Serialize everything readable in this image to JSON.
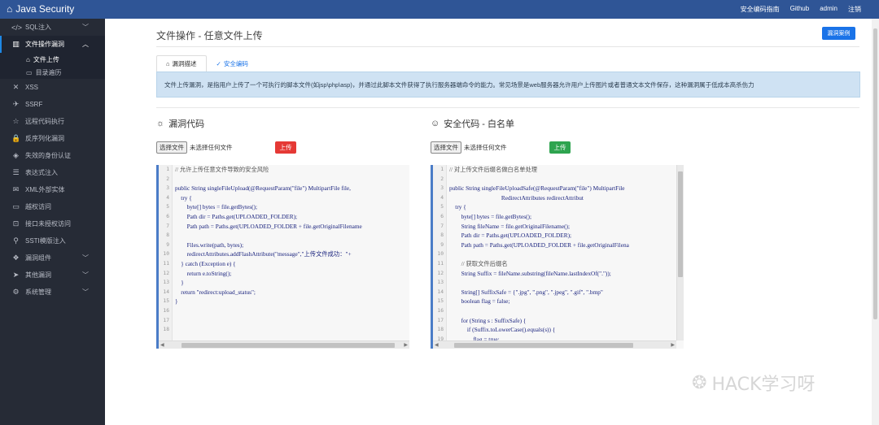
{
  "brand": {
    "title": "Java Security"
  },
  "topnav": [
    "安全编码指南",
    "Github",
    "admin",
    "注销"
  ],
  "sidebar": {
    "items": [
      {
        "label": "SQL注入",
        "icon": "code-icon",
        "glyph": "</>",
        "chevron": true
      },
      {
        "label": "文件操作漏洞",
        "icon": "file-icon",
        "glyph": "▥",
        "chevron": true,
        "open": true,
        "children": [
          {
            "label": "文件上传",
            "icon": "upload-icon",
            "glyph": "⌂",
            "current": true
          },
          {
            "label": "目录遍历",
            "icon": "folder-icon",
            "glyph": "▭"
          }
        ]
      },
      {
        "label": "XSS",
        "icon": "x-icon",
        "glyph": "✕"
      },
      {
        "label": "SSRF",
        "icon": "globe-icon",
        "glyph": "✈"
      },
      {
        "label": "远程代码执行",
        "icon": "star-icon",
        "glyph": "☆"
      },
      {
        "label": "反序列化漏洞",
        "icon": "lock-icon",
        "glyph": "🔒"
      },
      {
        "label": "失效的身份认证",
        "icon": "shield-icon",
        "glyph": "◈"
      },
      {
        "label": "表达式注入",
        "icon": "list-icon",
        "glyph": "☰"
      },
      {
        "label": "XML外部实体",
        "icon": "mail-icon",
        "glyph": "✉"
      },
      {
        "label": "越权访问",
        "icon": "monitor-icon",
        "glyph": "▭"
      },
      {
        "label": "接口未授权访问",
        "icon": "link-icon",
        "glyph": "⊡"
      },
      {
        "label": "SSTI模版注入",
        "icon": "plug-icon",
        "glyph": "⚲"
      },
      {
        "label": "漏洞组件",
        "icon": "component-icon",
        "glyph": "❖",
        "chevron": true
      },
      {
        "label": "其他漏洞",
        "icon": "send-icon",
        "glyph": "➤",
        "chevron": true
      },
      {
        "label": "系统管理",
        "icon": "settings-icon",
        "glyph": "⚙",
        "chevron": true
      }
    ]
  },
  "page": {
    "title": "文件操作 - 任意文件上传",
    "vuln_button": "漏洞案例",
    "tabs": [
      {
        "label": "漏洞描述",
        "icon": "bookmark-icon",
        "glyph": "⌂",
        "active": true
      },
      {
        "label": "安全编码",
        "icon": "shield-check-icon",
        "glyph": "✓",
        "active": false
      }
    ],
    "description": "文件上传漏洞，是指用户上传了一个可执行的脚本文件(如jsp\\php\\asp)，并通过此脚本文件获得了执行服务器端命令的能力。常见场景是web服务器允许用户上传图片或者普通文本文件保存，这种漏洞属于低成本高杀伤力"
  },
  "left_panel": {
    "title": "漏洞代码",
    "icon": "bug-icon",
    "choose_file": "选择文件",
    "no_file": "未选择任何文件",
    "upload": "上传",
    "upload_color": "#e53935",
    "line_numbers": [
      "1",
      "2",
      "3",
      "4",
      "5",
      "6",
      "7",
      "8",
      "9",
      "10",
      "11",
      "12",
      "13",
      "14",
      "15",
      "16",
      "17",
      "18"
    ],
    "lines": [
      "// 允许上传任意文件导致的安全风险",
      "",
      "public String singleFileUpload(@RequestParam(\"file\") MultipartFile file,",
      "    try {",
      "        byte[] bytes = file.getBytes();",
      "        Path dir = Paths.get(UPLOADED_FOLDER);",
      "        Path path = Paths.get(UPLOADED_FOLDER + file.getOriginalFilename",
      "",
      "        Files.write(path, bytes);",
      "        redirectAttributes.addFlashAttribute(\"message\",\"上传文件成功：\"+",
      "    } catch (Exception e) {",
      "        return e.toString();",
      "    }",
      "    return \"redirect:upload_status\";",
      "}",
      "",
      "",
      ""
    ]
  },
  "right_panel": {
    "title": "安全代码 - 白名单",
    "icon": "smile-icon",
    "choose_file": "选择文件",
    "no_file": "未选择任何文件",
    "upload": "上传",
    "upload_color": "#2ea44f",
    "line_numbers": [
      "1",
      "2",
      "3",
      "4",
      "5",
      "6",
      "7",
      "8",
      "9",
      "10",
      "11",
      "12",
      "13",
      "14",
      "15",
      "16",
      "17",
      "18",
      "19"
    ],
    "lines": [
      "// 对上传文件后缀名做白名单处理",
      "",
      "public String singleFileUploadSafe(@RequestParam(\"file\") MultipartFile",
      "                                   RedirectAttributes redirectAttribut",
      "    try {",
      "        byte[] bytes = file.getBytes();",
      "        String fileName = file.getOriginalFilename();",
      "        Path dir = Paths.get(UPLOADED_FOLDER);",
      "        Path path = Paths.get(UPLOADED_FOLDER + file.getOriginalFilena",
      "",
      "        // 获取文件后缀名",
      "        String Suffix = fileName.substring(fileName.lastIndexOf(\".\"));",
      "",
      "        String[] SuffixSafe = {\".jpg\", \".png\", \".jpeg\", \".gif\", \".bmp\"",
      "        boolean flag = false;",
      "",
      "        for (String s : SuffixSafe) {",
      "            if (Suffix.toLowerCase().equals(s)) {",
      "                flag = true;"
    ]
  },
  "watermark": "HACK学习呀",
  "colors": {
    "topbar": "#2f5596",
    "sidebar": "#262b36",
    "accent": "#1a73e8",
    "alert_bg": "#cfe2f3"
  }
}
